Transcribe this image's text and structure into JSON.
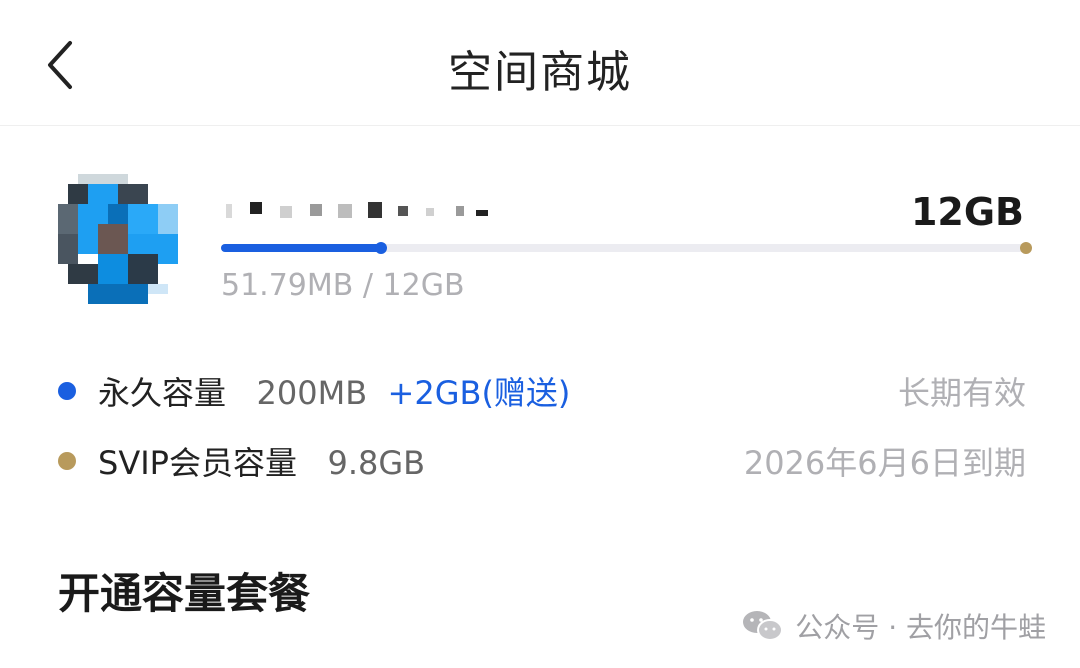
{
  "header": {
    "title": "空间商城"
  },
  "storage": {
    "total": "12GB",
    "usage_text": "51.79MB / 12GB",
    "permanent_fraction": 0.199,
    "colors": {
      "permanent": "#1a5fe0",
      "svip": "#b89a5c"
    }
  },
  "capacities": [
    {
      "name": "永久容量",
      "amount": "200MB",
      "gift": "+2GB(赠送)",
      "expiry": "长期有效",
      "color": "#1a5fe0"
    },
    {
      "name": "SVIP会员容量",
      "amount": "9.8GB",
      "gift": "",
      "expiry": "2026年6月6日到期",
      "color": "#b89a5c"
    }
  ],
  "section": {
    "title": "开通容量套餐"
  },
  "watermark": {
    "text": "公众号 · 去你的牛蛙",
    "icon": "wechat-icon"
  }
}
